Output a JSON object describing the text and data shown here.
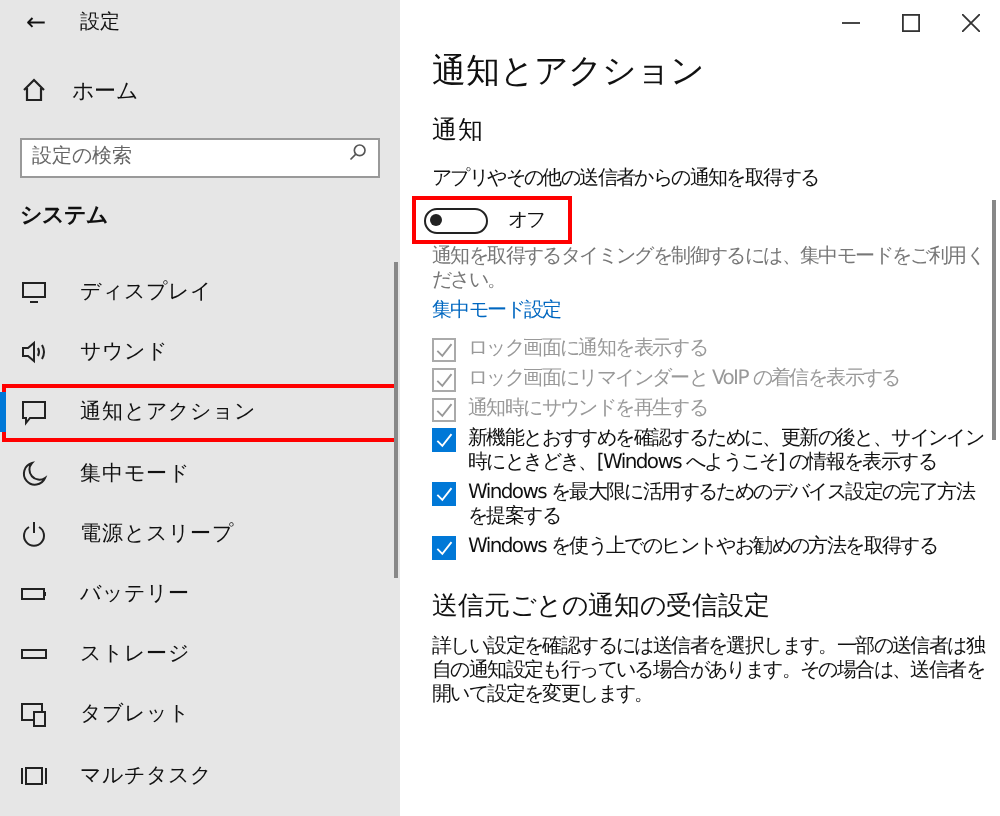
{
  "window": {
    "title": "設定",
    "back": "←"
  },
  "sidebar": {
    "home": "ホーム",
    "search": {
      "placeholder": "設定の検索"
    },
    "section": "システム",
    "items": [
      {
        "label": "ディスプレイ",
        "selected": false,
        "highlighted": false
      },
      {
        "label": "サウンド",
        "selected": false,
        "highlighted": false
      },
      {
        "label": "通知とアクション",
        "selected": true,
        "highlighted": true
      },
      {
        "label": "集中モード",
        "selected": false,
        "highlighted": false
      },
      {
        "label": "電源とスリープ",
        "selected": false,
        "highlighted": false
      },
      {
        "label": "バッテリー",
        "selected": false,
        "highlighted": false
      },
      {
        "label": "ストレージ",
        "selected": false,
        "highlighted": false
      },
      {
        "label": "タブレット",
        "selected": false,
        "highlighted": false
      },
      {
        "label": "マルチタスク",
        "selected": false,
        "highlighted": false
      }
    ]
  },
  "main": {
    "title": "通知とアクション",
    "section": "通知",
    "toggle_label": "アプリやその他の送信者からの通知を取得する",
    "toggle": {
      "on": false,
      "state_text": "オフ",
      "highlighted": true
    },
    "description": "通知を取得するタイミングを制御するには、集中モードをご利用ください。",
    "link": "集中モード設定",
    "checkboxes": [
      {
        "label": "ロック画面に通知を表示する",
        "checked": true,
        "disabled": true
      },
      {
        "label": "ロック画面にリマインダーと VoIP の着信を表示する",
        "checked": true,
        "disabled": true
      },
      {
        "label": "通知時にサウンドを再生する",
        "checked": true,
        "disabled": true
      },
      {
        "label": "新機能とおすすめを確認するために、更新の後と、サインイン時にときどき、[Windows へようこそ] の情報を表示する",
        "checked": true,
        "disabled": false
      },
      {
        "label": "Windows を最大限に活用するためのデバイス設定の完了方法を提案する",
        "checked": true,
        "disabled": false
      },
      {
        "label": "Windows を使う上でのヒントやお勧めの方法を取得する",
        "checked": true,
        "disabled": false
      }
    ],
    "section2": "送信元ごとの通知の受信設定",
    "paragraph": "詳しい設定を確認するには送信者を選択します。一部の送信者は独自の通知設定も行っている場合があります。その場合は、送信者を開いて設定を変更します。"
  }
}
